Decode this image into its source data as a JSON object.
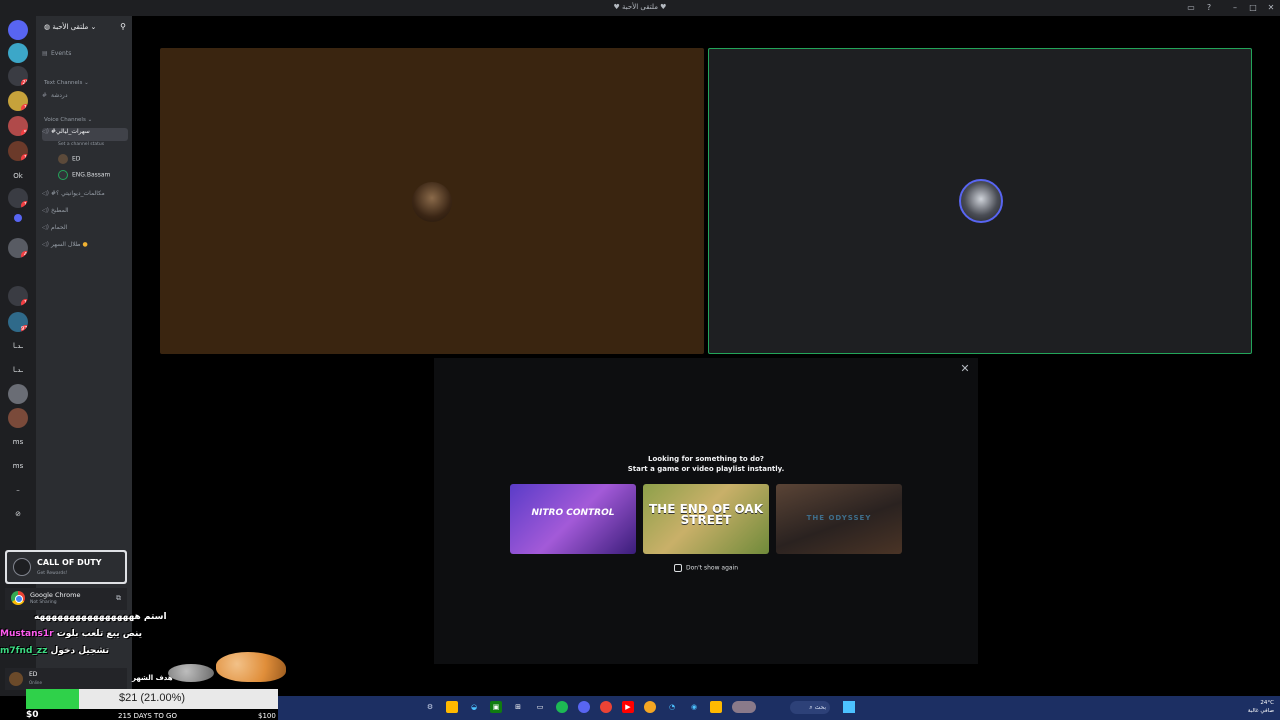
{
  "window": {
    "title": "♥ ملتقى الأحبة ♥",
    "controls": [
      "inbox-icon",
      "help-icon",
      "minimize-icon",
      "maximize-icon",
      "close-icon"
    ]
  },
  "servers": [
    {
      "label": "",
      "badge": ""
    },
    {
      "label": "",
      "badge": ""
    },
    {
      "label": "",
      "badge": "26"
    },
    {
      "label": "",
      "badge": "1"
    },
    {
      "label": "",
      "badge": "5"
    },
    {
      "label": "",
      "badge": "1"
    },
    {
      "label": "Ok",
      "badge": ""
    },
    {
      "label": "",
      "badge": "1"
    },
    {
      "label": "",
      "badge": ""
    },
    {
      "label": "",
      "badge": "4"
    },
    {
      "label": "",
      "badge": "1"
    },
    {
      "label": "",
      "badge": "972"
    },
    {
      "label": "ـدـا",
      "badge": ""
    },
    {
      "label": "ـدـا",
      "badge": ""
    },
    {
      "label": "",
      "badge": ""
    },
    {
      "label": "",
      "badge": ""
    },
    {
      "label": "ms",
      "badge": ""
    },
    {
      "label": "ms",
      "badge": ""
    },
    {
      "label": "–",
      "badge": ""
    },
    {
      "label": "⊘",
      "badge": ""
    }
  ],
  "sidebar": {
    "guild_name": "ملتقى الأحبة",
    "events_label": "Events",
    "text_category": "Text Channels",
    "text_channels": [
      "دردشة"
    ],
    "voice_category": "Voice Channels",
    "voice_active": "#سهرات_ليالي",
    "channel_status": "Set a channel status",
    "members": [
      "ED",
      "ENG.Bassam"
    ],
    "voice_channels": [
      "#مكالمات_ديوانيتي ؟",
      "المطبخ",
      "الحمام",
      "طلال السهر"
    ]
  },
  "activity": {
    "line1": "Looking for something to do?",
    "line2": "Start a game or video playlist instantly.",
    "cards": [
      "NITRO CONTROL",
      "THE END OF OAK STREET",
      "THE ODYSSEY"
    ],
    "dont_show": "Don't show again"
  },
  "game_card": {
    "name": "CALL OF DUTY",
    "sub": "Get Rewards!"
  },
  "share": {
    "title": "Google Chrome",
    "status": "Not Sharing"
  },
  "chat": [
    {
      "text": "استم هههههههههههههههههه",
      "color": "#ffffff"
    },
    {
      "user": "Mustans1r",
      "text": "ينص يبع تلعب بلوت",
      "color": "#ff5cf0"
    },
    {
      "user": "m7fnd_zz",
      "text": "تشجيل دخول",
      "color": "#3ddc84"
    }
  ],
  "user": {
    "name": "ED",
    "status": "Online"
  },
  "mascot_label": "هدف الشهر",
  "goal": {
    "text": "$21 (21.00%)",
    "progress": 0.21,
    "min": "$0",
    "days": "215 DAYS TO GO",
    "max": "$100"
  },
  "taskbar": {
    "search_label": "بحث",
    "clock": "24°C",
    "clock_sub": "صافي غالبة"
  }
}
